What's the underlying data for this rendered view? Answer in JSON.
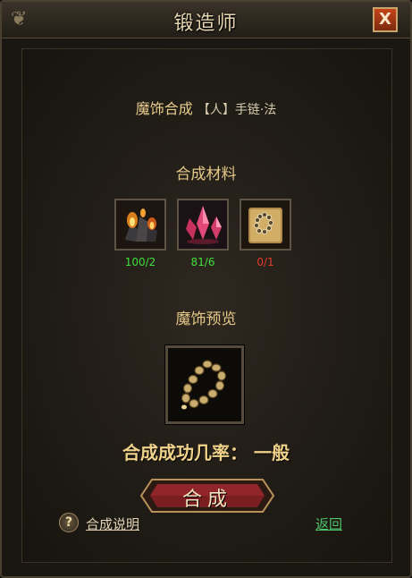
{
  "window": {
    "title": "锻造师",
    "close_label": "X"
  },
  "recipe": {
    "prefix": "魔饰合成",
    "item": "【人】手链·法"
  },
  "materials": {
    "title": "合成材料",
    "items": [
      {
        "icon": "fire-ore-icon",
        "count": "100/2",
        "color": "#3ee03a"
      },
      {
        "icon": "pink-crystal-icon",
        "count": "81/6",
        "color": "#3ee03a"
      },
      {
        "icon": "bracelet-scroll-icon",
        "count": "0/1",
        "color": "#e83a2a"
      }
    ]
  },
  "preview": {
    "title": "魔饰预览",
    "icon": "bead-bracelet-icon"
  },
  "success_rate": "合成成功几率： 一般",
  "buttons": {
    "craft": "合成",
    "help": "合成说明",
    "back": "返回",
    "help_icon": "?"
  },
  "colors": {
    "gold_text": "#e4c887",
    "ok": "#3ee03a",
    "missing": "#e83a2a",
    "link": "#4fc46a"
  }
}
